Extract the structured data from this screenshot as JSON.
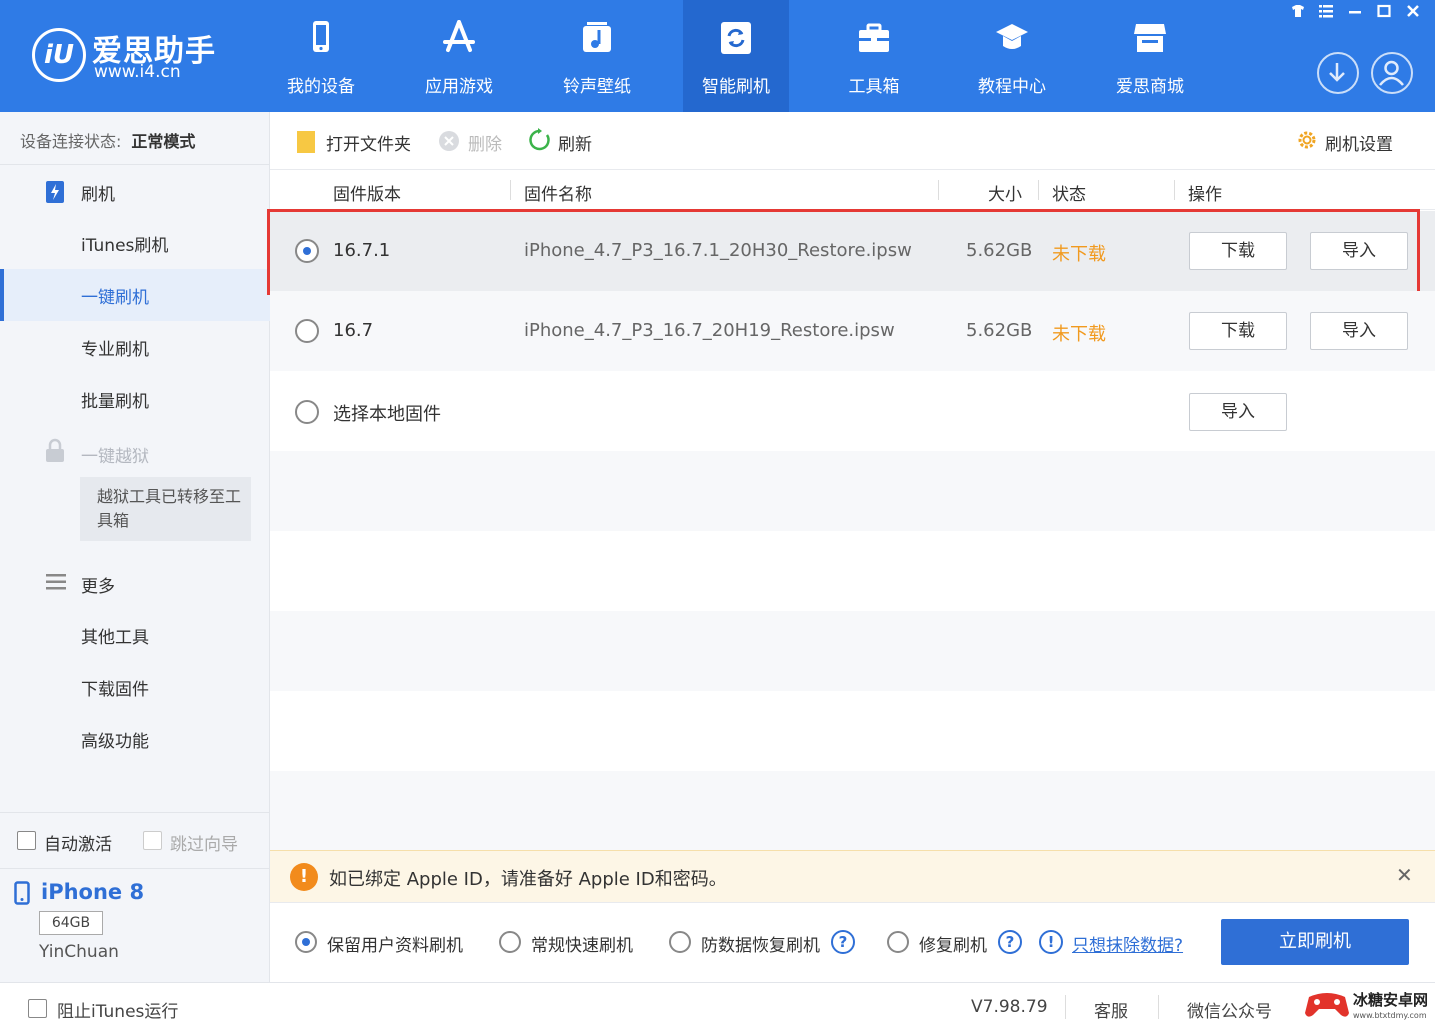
{
  "app": {
    "logo_text": "爱思助手",
    "logo_mark": "iU",
    "logo_url": "www.i4.cn"
  },
  "nav": [
    {
      "label": "我的设备",
      "icon": "phone-icon"
    },
    {
      "label": "应用游戏",
      "icon": "app-store-icon"
    },
    {
      "label": "铃声壁纸",
      "icon": "music-icon"
    },
    {
      "label": "智能刷机",
      "icon": "refresh-box-icon",
      "active": true
    },
    {
      "label": "工具箱",
      "icon": "toolbox-icon"
    },
    {
      "label": "教程中心",
      "icon": "graduation-cap-icon"
    },
    {
      "label": "爱思商城",
      "icon": "store-icon"
    }
  ],
  "window_controls": [
    "shirt-icon",
    "list-icon",
    "minimize-icon",
    "maximize-icon",
    "close-icon"
  ],
  "sidebar": {
    "conn_label": "设备连接状态:",
    "conn_value": "正常模式",
    "group_flash": "刷机",
    "items": [
      "iTunes刷机",
      "一键刷机",
      "专业刷机",
      "批量刷机"
    ],
    "active_item": "一键刷机",
    "group_jailbreak": "一键越狱",
    "jailbreak_note": "越狱工具已转移至工具箱",
    "group_more": "更多",
    "more_items": [
      "其他工具",
      "下载固件",
      "高级功能"
    ],
    "auto_activate": "自动激活",
    "skip_guide": "跳过向导",
    "device_name": "iPhone 8",
    "device_capacity": "64GB",
    "device_user": "YinChuan"
  },
  "toolbar": {
    "open_folder": "打开文件夹",
    "delete": "删除",
    "refresh": "刷新",
    "settings": "刷机设置"
  },
  "table": {
    "headers": {
      "version": "固件版本",
      "name": "固件名称",
      "size": "大小",
      "status": "状态",
      "action": "操作"
    },
    "rows": [
      {
        "version": "16.7.1",
        "name": "iPhone_4.7_P3_16.7.1_20H30_Restore.ipsw",
        "size": "5.62GB",
        "status": "未下载",
        "btn_download": "下载",
        "btn_import": "导入",
        "selected": true
      },
      {
        "version": "16.7",
        "name": "iPhone_4.7_P3_16.7_20H19_Restore.ipsw",
        "size": "5.62GB",
        "status": "未下载",
        "btn_download": "下载",
        "btn_import": "导入",
        "selected": false
      }
    ],
    "local_label": "选择本地固件",
    "local_import": "导入"
  },
  "warning": {
    "icon_text": "!",
    "text": "如已绑定 Apple ID，请准备好 Apple ID和密码。",
    "close": "✕"
  },
  "modes": {
    "keep_data": "保留用户资料刷机",
    "quick": "常规快速刷机",
    "anti_recovery": "防数据恢复刷机",
    "repair": "修复刷机",
    "erase_link": "只想抹除数据?",
    "help_mark": "?",
    "info_mark": "!",
    "flash_now": "立即刷机"
  },
  "status_bar": {
    "block_itunes": "阻止iTunes运行",
    "version": "V7.98.79",
    "service": "客服",
    "wechat": "微信公众号"
  },
  "watermark": {
    "text": "冰糖安卓网",
    "url": "www.btxtdmy.com"
  },
  "colors": {
    "header_blue": "#2f7be6",
    "accent_blue": "#2f6fd6",
    "status_orange": "#f19a1f",
    "highlight_red": "#e53935"
  }
}
